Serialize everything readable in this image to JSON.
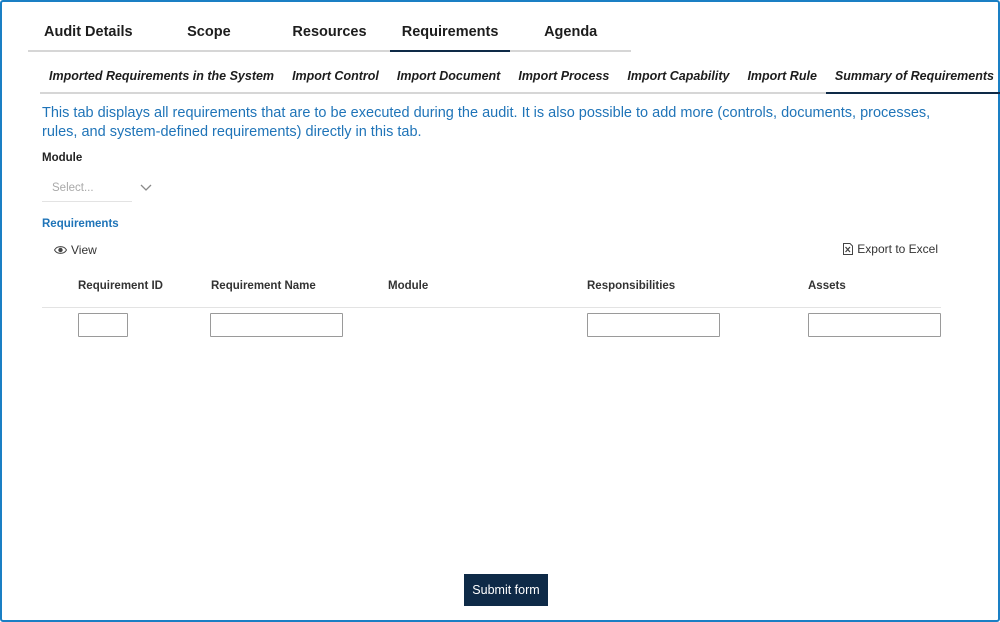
{
  "main_tabs": [
    {
      "label": "Audit Details"
    },
    {
      "label": "Scope"
    },
    {
      "label": "Resources"
    },
    {
      "label": "Requirements",
      "active": true
    },
    {
      "label": "Agenda"
    }
  ],
  "sub_tabs": [
    {
      "label": "Imported Requirements in the System"
    },
    {
      "label": "Import Control"
    },
    {
      "label": "Import Document"
    },
    {
      "label": "Import Process"
    },
    {
      "label": "Import Capability"
    },
    {
      "label": "Import Rule"
    },
    {
      "label": "Summary of Requirements",
      "active": true
    }
  ],
  "description": "This tab displays all requirements that are to be executed during the audit. It is also possible to add more (controls, documents, processes, rules, and system-defined requirements) directly in this tab.",
  "module_field": {
    "label": "Module",
    "placeholder": "Select..."
  },
  "requirements": {
    "section_label": "Requirements",
    "view_label": "View",
    "export_label": "Export to Excel",
    "columns": [
      "Requirement ID",
      "Requirement Name",
      "Module",
      "Responsibilities",
      "Assets"
    ]
  },
  "submit_label": "Submit form",
  "colors": {
    "accent": "#1f74b8",
    "primary": "#0e2a47",
    "frame": "#1a7fc4"
  },
  "icons": {
    "view": "eye-icon",
    "export": "excel-file-icon",
    "select": "chevron-down-icon"
  }
}
